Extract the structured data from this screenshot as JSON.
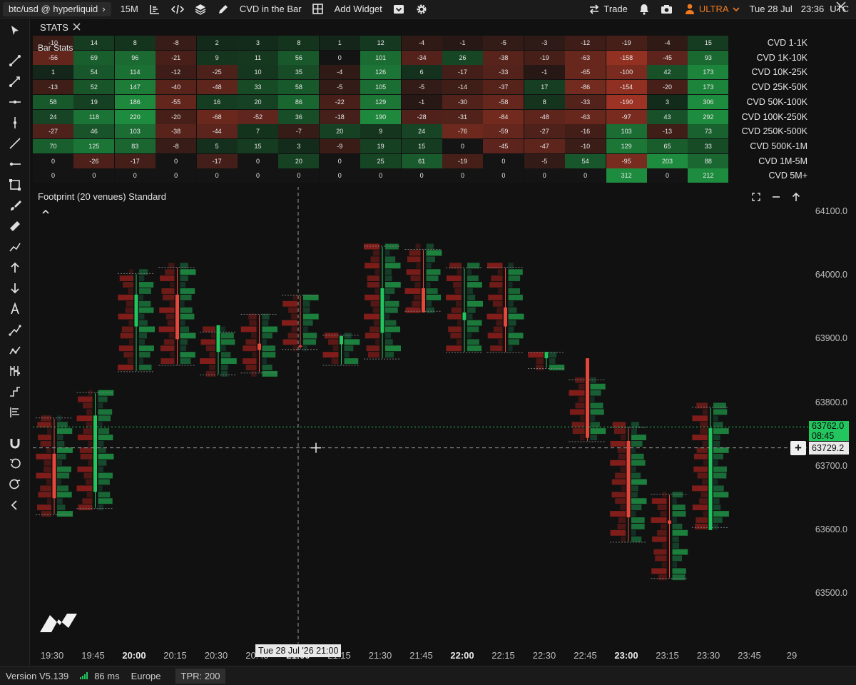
{
  "topbar": {
    "symbol": "btc/usd @ hyperliquid",
    "timeframe": "15M",
    "cvd_in_bar": "CVD in the Bar",
    "add_widget": "Add Widget",
    "trade": "Trade",
    "account": "ULTRA",
    "date": "Tue 28 Jul",
    "time": "23:36",
    "timezone": "UTC"
  },
  "stats": {
    "tab_label": "STATS",
    "panel_title": "Bar Stats",
    "row_labels": [
      "CVD 1-1K",
      "CVD 1K-10K",
      "CVD 10K-25K",
      "CVD 25K-50K",
      "CVD 50K-100K",
      "CVD 100K-250K",
      "CVD 250K-500K",
      "CVD 500K-1M",
      "CVD 1M-5M",
      "CVD 5M+"
    ],
    "rows": [
      [
        "-10",
        "14",
        "8",
        "-8",
        "2",
        "3",
        "8",
        "1",
        "12",
        "-4",
        "-1",
        "-5",
        "-3",
        "-12",
        "-19",
        "-4",
        "15"
      ],
      [
        "-56",
        "69",
        "96",
        "-21",
        "9",
        "11",
        "56",
        "0",
        "101",
        "-34",
        "26",
        "-38",
        "-19",
        "-63",
        "-158",
        "-45",
        "93"
      ],
      [
        "1",
        "54",
        "114",
        "-12",
        "-25",
        "10",
        "35",
        "-4",
        "126",
        "6",
        "-17",
        "-33",
        "-1",
        "-65",
        "-100",
        "42",
        "173"
      ],
      [
        "-13",
        "52",
        "147",
        "-40",
        "-48",
        "33",
        "58",
        "-5",
        "105",
        "-5",
        "-14",
        "-37",
        "17",
        "-86",
        "-154",
        "-20",
        "173"
      ],
      [
        "58",
        "19",
        "186",
        "-55",
        "16",
        "20",
        "86",
        "-22",
        "129",
        "-1",
        "-30",
        "-58",
        "8",
        "-33",
        "-190",
        "3",
        "306"
      ],
      [
        "24",
        "118",
        "220",
        "-20",
        "-68",
        "-52",
        "36",
        "-18",
        "190",
        "-28",
        "-31",
        "-84",
        "-48",
        "-63",
        "-97",
        "43",
        "292"
      ],
      [
        "-27",
        "46",
        "103",
        "-38",
        "-44",
        "7",
        "-7",
        "20",
        "9",
        "24",
        "-76",
        "-59",
        "-27",
        "-16",
        "103",
        "-13",
        "73"
      ],
      [
        "70",
        "125",
        "83",
        "-8",
        "5",
        "15",
        "3",
        "-9",
        "19",
        "15",
        "0",
        "-45",
        "-47",
        "-10",
        "129",
        "65",
        "33"
      ],
      [
        "0",
        "-26",
        "-17",
        "0",
        "-17",
        "0",
        "20",
        "0",
        "25",
        "61",
        "-19",
        "0",
        "-5",
        "54",
        "-95",
        "203",
        "88"
      ],
      [
        "0",
        "0",
        "0",
        "0",
        "0",
        "0",
        "0",
        "0",
        "0",
        "0",
        "0",
        "0",
        "0",
        "0",
        "312",
        "0",
        "212"
      ]
    ]
  },
  "chart": {
    "title": "Footprint (20 venues) Standard",
    "price_ticks": [
      "64100.0",
      "64000.0",
      "63900.0",
      "63800.0",
      "63700.0",
      "63600.0",
      "63500.0"
    ],
    "time_ticks": [
      "19:30",
      "19:45",
      "20:00",
      "20:15",
      "20:30",
      "20:45",
      "21:00",
      "21:15",
      "21:30",
      "21:45",
      "22:00",
      "22:15",
      "22:30",
      "22:45",
      "23:00",
      "23:15",
      "23:30",
      "23:45",
      "29"
    ],
    "bold_ticks": [
      "20:00",
      "21:00",
      "22:00",
      "23:00"
    ],
    "last_price": "63762.0",
    "countdown": "08:45",
    "crosshair_price": "63729.2",
    "crosshair_time": "Tue 28 Jul '26 21:00",
    "colors": {
      "up": "#22c55e",
      "down": "#e5483a",
      "last": "#22c55e"
    }
  },
  "chart_data": {
    "type": "footprint",
    "x": [
      "19:30",
      "19:45",
      "20:00",
      "20:15",
      "20:30",
      "20:45",
      "21:00",
      "21:15",
      "21:30",
      "21:45",
      "22:00",
      "22:15",
      "22:30",
      "22:45",
      "23:00",
      "23:15",
      "23:30"
    ],
    "open": [
      63720,
      63660,
      63920,
      63970,
      63880,
      63893,
      63890,
      63892,
      63910,
      63980,
      63930,
      63950,
      63870,
      63870,
      63740,
      63615,
      63600
    ],
    "close": [
      63650,
      63780,
      63970,
      63900,
      63922,
      63883,
      63889,
      63905,
      63980,
      63942,
      63942,
      63920,
      63880,
      63745,
      63620,
      63610,
      63760
    ],
    "high": [
      63775,
      63815,
      64002,
      64012,
      63910,
      63938,
      63968,
      63905,
      64045,
      64040,
      64011,
      64012,
      63878,
      63835,
      63760,
      63655,
      63792
    ],
    "low": [
      63625,
      63635,
      63850,
      63860,
      63845,
      63848,
      63885,
      63860,
      63870,
      63945,
      63880,
      63880,
      63855,
      63740,
      63582,
      63525,
      63605
    ],
    "ylim": [
      63440,
      64150
    ]
  },
  "footer": {
    "version": "Version V5.139",
    "latency": "86 ms",
    "region": "Europe",
    "tpr": "TPR: 200"
  }
}
